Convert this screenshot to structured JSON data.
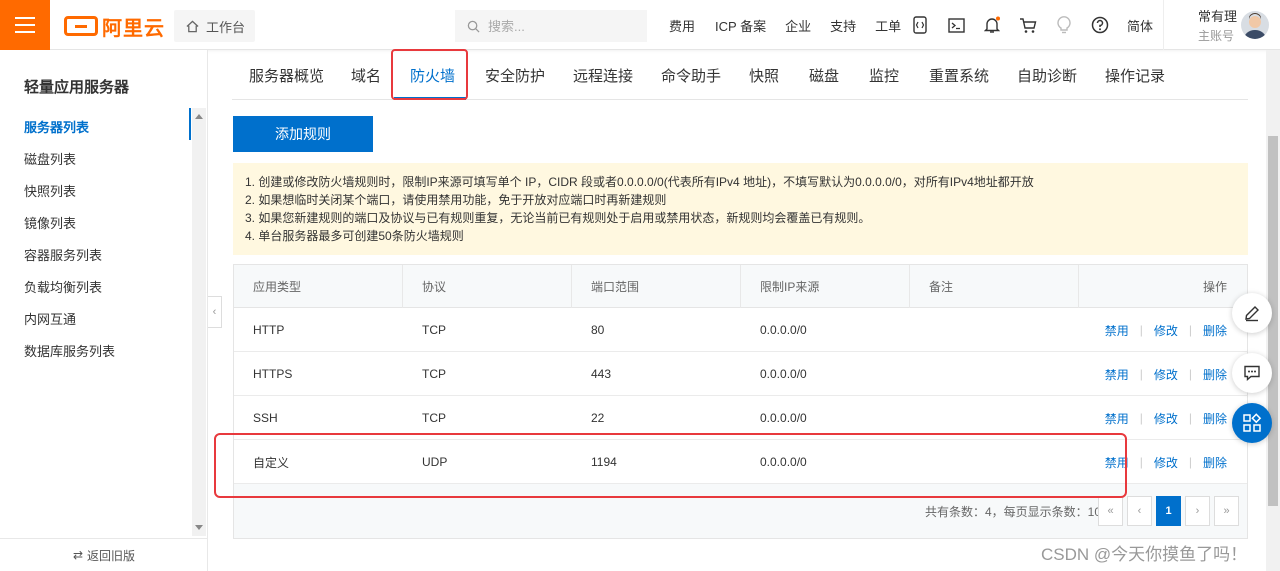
{
  "topbar": {
    "logo_text": "阿里云",
    "workbench": "工作台",
    "search_placeholder": "搜索...",
    "links": [
      "费用",
      "ICP 备案",
      "企业",
      "支持",
      "工单"
    ],
    "lang": "简体",
    "user_name": "常有理",
    "user_sub": "主账号",
    "accent": "#ff6a00"
  },
  "sidebar": {
    "title": "轻量应用服务器",
    "items": [
      "服务器列表",
      "磁盘列表",
      "快照列表",
      "镜像列表",
      "容器服务列表",
      "负载均衡列表",
      "内网互通",
      "数据库服务列表"
    ],
    "active_index": 0,
    "footer": "返回旧版"
  },
  "tabs": [
    "服务器概览",
    "域名",
    "防火墙",
    "安全防护",
    "远程连接",
    "命令助手",
    "快照",
    "磁盘",
    "监控",
    "重置系统",
    "自助诊断",
    "操作记录"
  ],
  "active_tab": "防火墙",
  "add_rule_button": "添加规则",
  "notice": [
    "1. 创建或修改防火墙规则时，限制IP来源可填写单个 IP，CIDR 段或者0.0.0.0/0(代表所有IPv4 地址)，不填写默认为0.0.0.0/0，对所有IPv4地址都开放",
    "2. 如果想临时关闭某个端口，请使用禁用功能，免于开放对应端口时再新建规则",
    "3. 如果您新建规则的端口及协议与已有规则重复，无论当前已有规则处于启用或禁用状态，新规则均会覆盖已有规则。",
    "4. 单台服务器最多可创建50条防火墙规则"
  ],
  "table": {
    "headers": [
      "应用类型",
      "协议",
      "端口范围",
      "限制IP来源",
      "备注",
      "操作"
    ],
    "rows": [
      {
        "type": "HTTP",
        "protocol": "TCP",
        "port": "80",
        "source": "0.0.0.0/0",
        "remark": ""
      },
      {
        "type": "HTTPS",
        "protocol": "TCP",
        "port": "443",
        "source": "0.0.0.0/0",
        "remark": ""
      },
      {
        "type": "SSH",
        "protocol": "TCP",
        "port": "22",
        "source": "0.0.0.0/0",
        "remark": ""
      },
      {
        "type": "自定义",
        "protocol": "UDP",
        "port": "1194",
        "source": "0.0.0.0/0",
        "remark": ""
      }
    ],
    "ops": {
      "disable": "禁用",
      "edit": "修改",
      "delete": "删除",
      "sep": "|"
    }
  },
  "pagination": {
    "info": "共有条数：4，每页显示条数：10",
    "first": "«",
    "prev": "‹",
    "current": "1",
    "next": "›",
    "last": "»"
  },
  "watermark": "CSDN @今天你摸鱼了吗！"
}
